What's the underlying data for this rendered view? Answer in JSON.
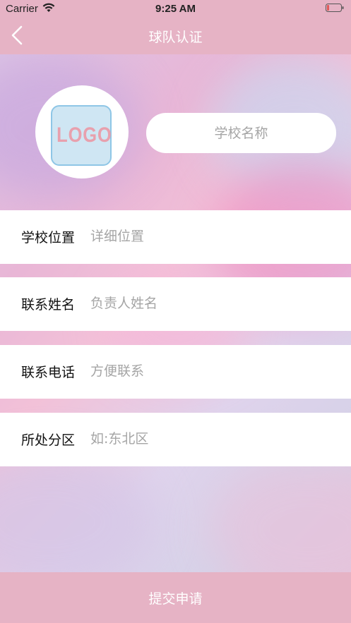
{
  "status_bar": {
    "carrier": "Carrier",
    "time": "9:25 AM"
  },
  "nav": {
    "title": "球队认证",
    "back_icon": "chevron-left-icon"
  },
  "logo": {
    "text": "LOGO"
  },
  "school_name": {
    "placeholder": "学校名称",
    "value": ""
  },
  "form": {
    "rows": [
      {
        "label": "学校位置",
        "placeholder": "详细位置",
        "value": ""
      },
      {
        "label": "联系姓名",
        "placeholder": "负责人姓名",
        "value": ""
      },
      {
        "label": "联系电话",
        "placeholder": "方便联系",
        "value": ""
      },
      {
        "label": "所处分区",
        "placeholder": "如:东北区",
        "value": ""
      }
    ]
  },
  "submit": {
    "label": "提交申请"
  },
  "colors": {
    "bar": "#e6b3c5",
    "battery_low": "#e05a5a"
  }
}
